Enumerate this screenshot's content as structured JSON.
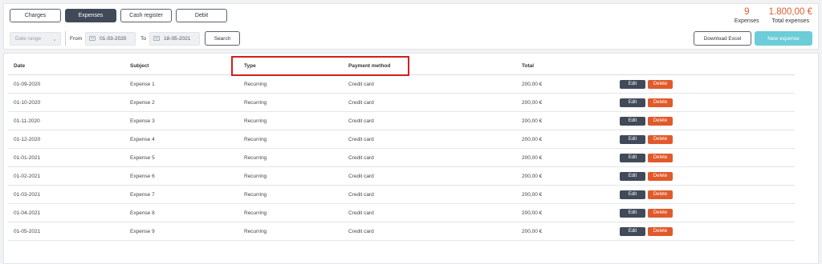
{
  "tabs": [
    {
      "label": "Charges",
      "active": false
    },
    {
      "label": "Expenses",
      "active": true
    },
    {
      "label": "Cash register",
      "active": false
    },
    {
      "label": "Debit",
      "active": false
    }
  ],
  "summary": {
    "count_value": "9",
    "count_label": "Expenses",
    "total_value": "1.800,00 €",
    "total_label": "Total expenses"
  },
  "filters": {
    "date_range_placeholder": "Date range",
    "from_label": "From",
    "from_date": "01-03-2020",
    "to_label": "To",
    "to_date": "18-05-2021",
    "search_label": "Search",
    "calendar_icon_text": "31"
  },
  "actions": {
    "download_label": "Download Excel",
    "new_label": "New expense"
  },
  "table": {
    "headers": [
      "Date",
      "Subject",
      "Type",
      "Payment method",
      "Total"
    ],
    "rows": [
      {
        "date": "01-09-2020",
        "subject": "Expense 1",
        "type": "Recurring",
        "payment": "Credit card",
        "total": "200,00 €"
      },
      {
        "date": "01-10-2020",
        "subject": "Expense 2",
        "type": "Recurring",
        "payment": "Credit card",
        "total": "200,00 €"
      },
      {
        "date": "01-11-2020",
        "subject": "Expense 3",
        "type": "Recurring",
        "payment": "Credit card",
        "total": "200,00 €"
      },
      {
        "date": "01-12-2020",
        "subject": "Expense 4",
        "type": "Recurring",
        "payment": "Credit card",
        "total": "200,00 €"
      },
      {
        "date": "01-01-2021",
        "subject": "Expense 5",
        "type": "Recurring",
        "payment": "Credit card",
        "total": "200,00 €"
      },
      {
        "date": "01-02-2021",
        "subject": "Expense 6",
        "type": "Recurring",
        "payment": "Credit card",
        "total": "200,00 €"
      },
      {
        "date": "01-03-2021",
        "subject": "Expense 7",
        "type": "Recurring",
        "payment": "Credit card",
        "total": "200,00 €"
      },
      {
        "date": "01-04-2021",
        "subject": "Expense 8",
        "type": "Recurring",
        "payment": "Credit card",
        "total": "200,00 €"
      },
      {
        "date": "01-05-2021",
        "subject": "Expense 9",
        "type": "Recurring",
        "payment": "Credit card",
        "total": "200,00 €"
      }
    ],
    "edit_label": "Edit",
    "delete_label": "Delete"
  },
  "colors": {
    "accent_dark": "#414a59",
    "accent_orange": "#e05a2b",
    "accent_teal": "#6ccdd8",
    "highlight_red": "#d11f1f"
  }
}
